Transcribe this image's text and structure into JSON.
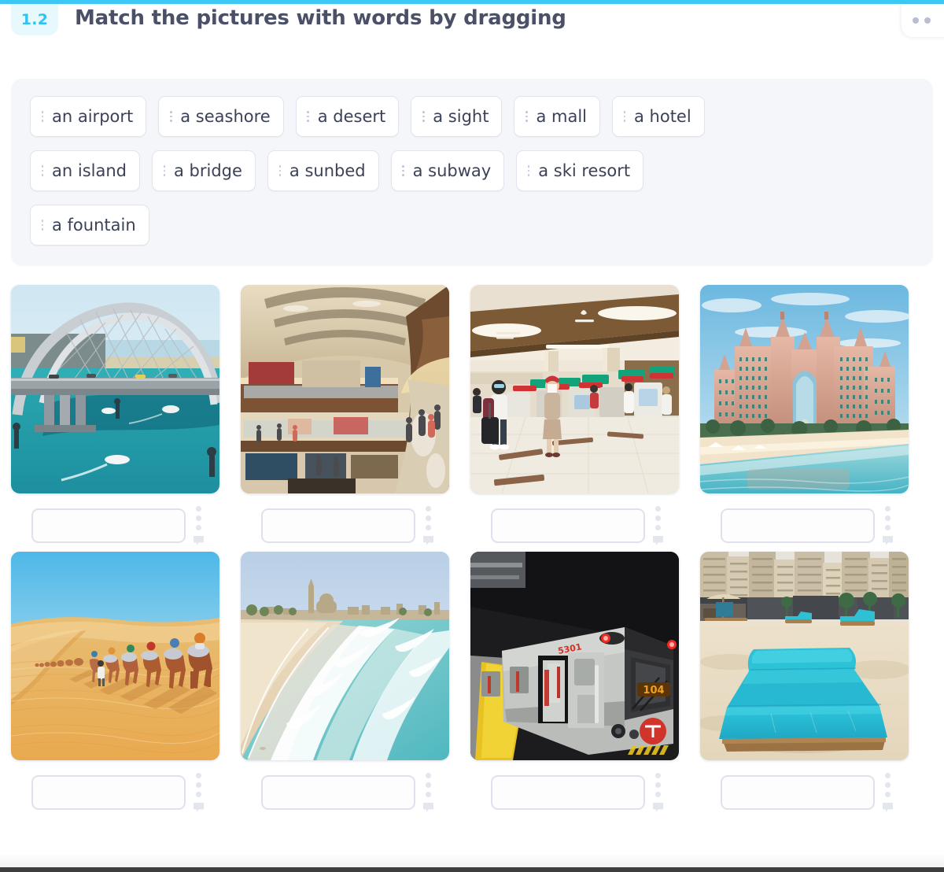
{
  "header": {
    "badge": "1.2",
    "title": "Match the pictures with words by dragging",
    "menu_icon": "ellipsis-icon",
    "accent_color": "#3bc8f5",
    "badge_bg": "#e8f9fe",
    "title_color": "#4a5068"
  },
  "wordbank": {
    "background": "#f4f6fa",
    "rows": [
      [
        {
          "label": "an airport"
        },
        {
          "label": "a seashore"
        },
        {
          "label": "a desert"
        },
        {
          "label": "a sight"
        },
        {
          "label": "a mall"
        },
        {
          "label": "a hotel"
        }
      ],
      [
        {
          "label": "an island"
        },
        {
          "label": "a bridge"
        },
        {
          "label": "a sunbed"
        },
        {
          "label": "a subway"
        },
        {
          "label": "a ski resort"
        }
      ],
      [
        {
          "label": "a fountain"
        }
      ]
    ]
  },
  "grid": {
    "dropzone_placeholder": "",
    "rows": [
      [
        {
          "image_name": "bridge-photo",
          "answer": ""
        },
        {
          "image_name": "mall-interior-photo",
          "answer": ""
        },
        {
          "image_name": "airport-checkin-photo",
          "answer": ""
        },
        {
          "image_name": "hotel-atlantis-photo",
          "answer": ""
        }
      ],
      [
        {
          "image_name": "desert-camels-photo",
          "answer": ""
        },
        {
          "image_name": "seashore-waves-photo",
          "answer": ""
        },
        {
          "image_name": "subway-train-photo",
          "answer": ""
        },
        {
          "image_name": "sunbed-beach-photo",
          "answer": ""
        }
      ]
    ]
  }
}
